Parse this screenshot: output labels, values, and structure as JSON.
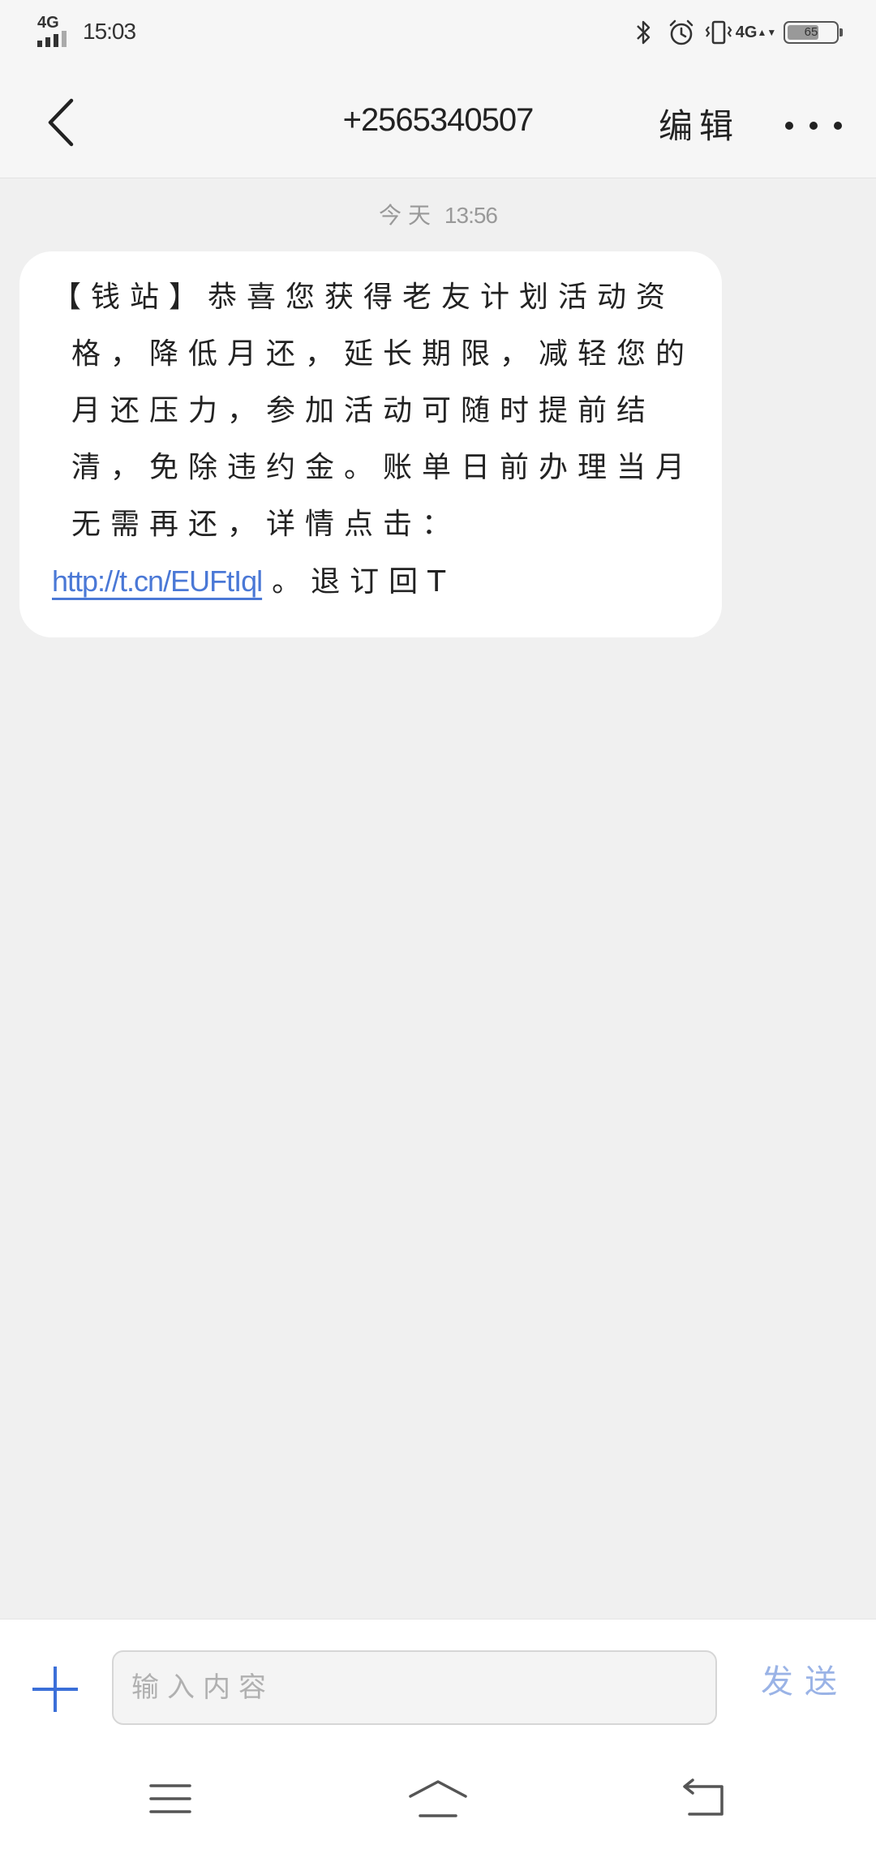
{
  "status_bar": {
    "network_left": "4G",
    "time": "15:03",
    "network_right": "4G",
    "network_right_arrows": "▲▼",
    "battery_level": "65",
    "battery_fraction": 0.65
  },
  "header": {
    "title": "+2565340507",
    "edit_label": "编辑"
  },
  "conversation": {
    "timestamp_day": "今天",
    "timestamp_time": "13:56",
    "message": {
      "lines": [
        "【钱站】恭喜您获得老友计划活动资",
        "格，降低月还，延长期限，减轻您的",
        "月还压力，参加活动可随时提前结",
        "清，免除违约金。账单日前办理当月",
        "无需再还，详情点击："
      ],
      "link": "http://t.cn/EUFtIql",
      "after_link": "。退订回T"
    }
  },
  "composer": {
    "placeholder": "输入内容",
    "send_label": "发送"
  },
  "icons": {
    "back": "chevron-left-icon",
    "more": "more-dots-icon",
    "add": "plus-icon",
    "menu": "menu-icon",
    "home": "home-icon",
    "return": "back-arrow-icon"
  },
  "colors": {
    "accent": "#3b6fd8",
    "link": "#4a78d6",
    "send_disabled": "#9ab3e6",
    "background": "#f0f0f0",
    "bubble": "#ffffff"
  }
}
